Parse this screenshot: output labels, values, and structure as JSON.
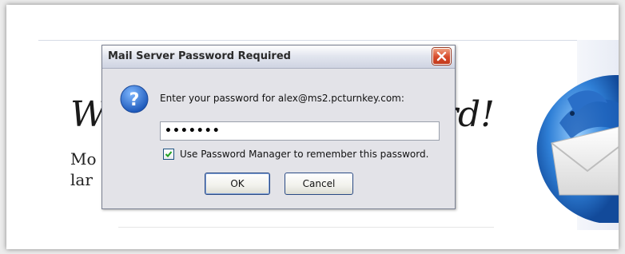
{
  "background_page": {
    "heading_left": "W",
    "heading_right": "rd!",
    "text_lines": [
      "Mo",
      "lar"
    ]
  },
  "dialog": {
    "title": "Mail Server Password Required",
    "prompt": "Enter your password for alex@ms2.pcturnkey.com:",
    "password_value": "•••••••",
    "remember_checked": true,
    "remember_label": "Use Password Manager to remember this password.",
    "ok_label": "OK",
    "cancel_label": "Cancel"
  },
  "icons": {
    "close": "close-icon",
    "question": "question-icon",
    "checkmark": "checkmark-icon",
    "logo": "thunderbird-logo"
  },
  "colors": {
    "close_button": "#d64a2a",
    "question_icon": "#2a6fc8",
    "dialog_body": "#e3e3e8"
  }
}
